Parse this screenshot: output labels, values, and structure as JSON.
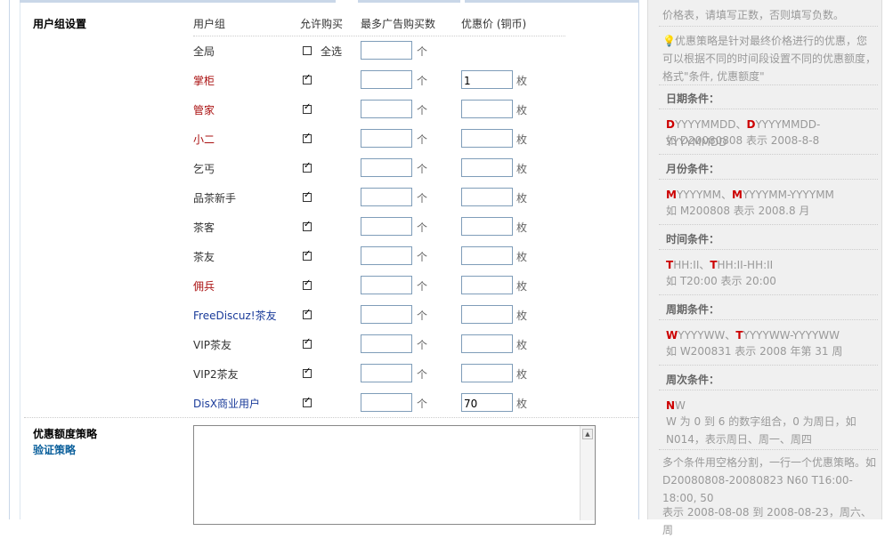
{
  "group_settings": {
    "label": "用户组设置",
    "headers": {
      "group": "用户组",
      "allow": "允许购买",
      "max": "最多广告购买数",
      "price": "优惠价 (铜币)"
    },
    "select_all": "全选",
    "unit_count": "个",
    "unit_price": "枚",
    "rows": [
      {
        "name": "全局",
        "color": "#333333",
        "checked": false,
        "global": true,
        "price": ""
      },
      {
        "name": "掌柜",
        "color": "#aa1111",
        "checked": true,
        "price": "1"
      },
      {
        "name": "管家",
        "color": "#aa1111",
        "checked": true,
        "price": ""
      },
      {
        "name": "小二",
        "color": "#aa1111",
        "checked": true,
        "price": ""
      },
      {
        "name": "乞丐",
        "color": "#333333",
        "checked": true,
        "price": ""
      },
      {
        "name": "品茶新手",
        "color": "#333333",
        "checked": true,
        "price": ""
      },
      {
        "name": "茶客",
        "color": "#333333",
        "checked": true,
        "price": ""
      },
      {
        "name": "茶友",
        "color": "#333333",
        "checked": true,
        "price": ""
      },
      {
        "name": "佣兵",
        "color": "#aa1111",
        "checked": true,
        "price": ""
      },
      {
        "name": "FreeDiscuz!茶友",
        "color": "#1a3b9a",
        "checked": true,
        "price": ""
      },
      {
        "name": "VIP茶友",
        "color": "#333333",
        "checked": true,
        "price": ""
      },
      {
        "name": "VIP2茶友",
        "color": "#333333",
        "checked": true,
        "price": ""
      },
      {
        "name": "DisX商业用户",
        "color": "#1a3b9a",
        "checked": true,
        "price": "70"
      }
    ]
  },
  "discount_policy": {
    "label": "优惠额度策略",
    "verify_link": "验证策略"
  },
  "sidebar": {
    "top_note": "价格表，请填写正数，否则填写负数。",
    "tip": "优惠策略是针对最终价格进行的优惠，您可以根据不同的时间段设置不同的优惠额度，格式\"条件, 优惠额度\"",
    "date_title": "日期条件：",
    "date_fmt_a": "D",
    "date_fmt_a_rest": "YYYYMMDD、",
    "date_fmt_b": "D",
    "date_fmt_b_rest": "YYYYMMDD-YYYYMMDD",
    "date_example": "如 D20080808 表示 2008-8-8",
    "month_title": "月份条件：",
    "month_a": "M",
    "month_a_rest": "YYYYMM、",
    "month_b": "M",
    "month_b_rest": "YYYYMM-YYYYMM",
    "month_example": "如 M200808 表示 2008.8 月",
    "time_title": "时间条件：",
    "time_a": "T",
    "time_a_rest": "HH:II、",
    "time_b": "T",
    "time_b_rest": "HH:II-HH:II",
    "time_example": "如 T20:00 表示 20:00",
    "week_title": "周期条件：",
    "week_a": "W",
    "week_a_rest": "YYYYWW、",
    "week_b": "T",
    "week_b_rest": "YYYYWW-YYYYWW",
    "week_example": "如 W200831 表示 2008 年第 31 周",
    "weekday_title": "周次条件：",
    "weekday_a": "N",
    "weekday_a_rest": "W",
    "weekday_desc": "W 为 0 到 6 的数字组合，0 为周日，如 N014，表示周日、周一、周四",
    "multi_desc": "多个条件用空格分割，一行一个优惠策略。如 D20080808-20080823 N60 T16:00-18:00, 50",
    "multi_example": "表示 2008-08-08 到 2008-08-23，周六、周"
  }
}
